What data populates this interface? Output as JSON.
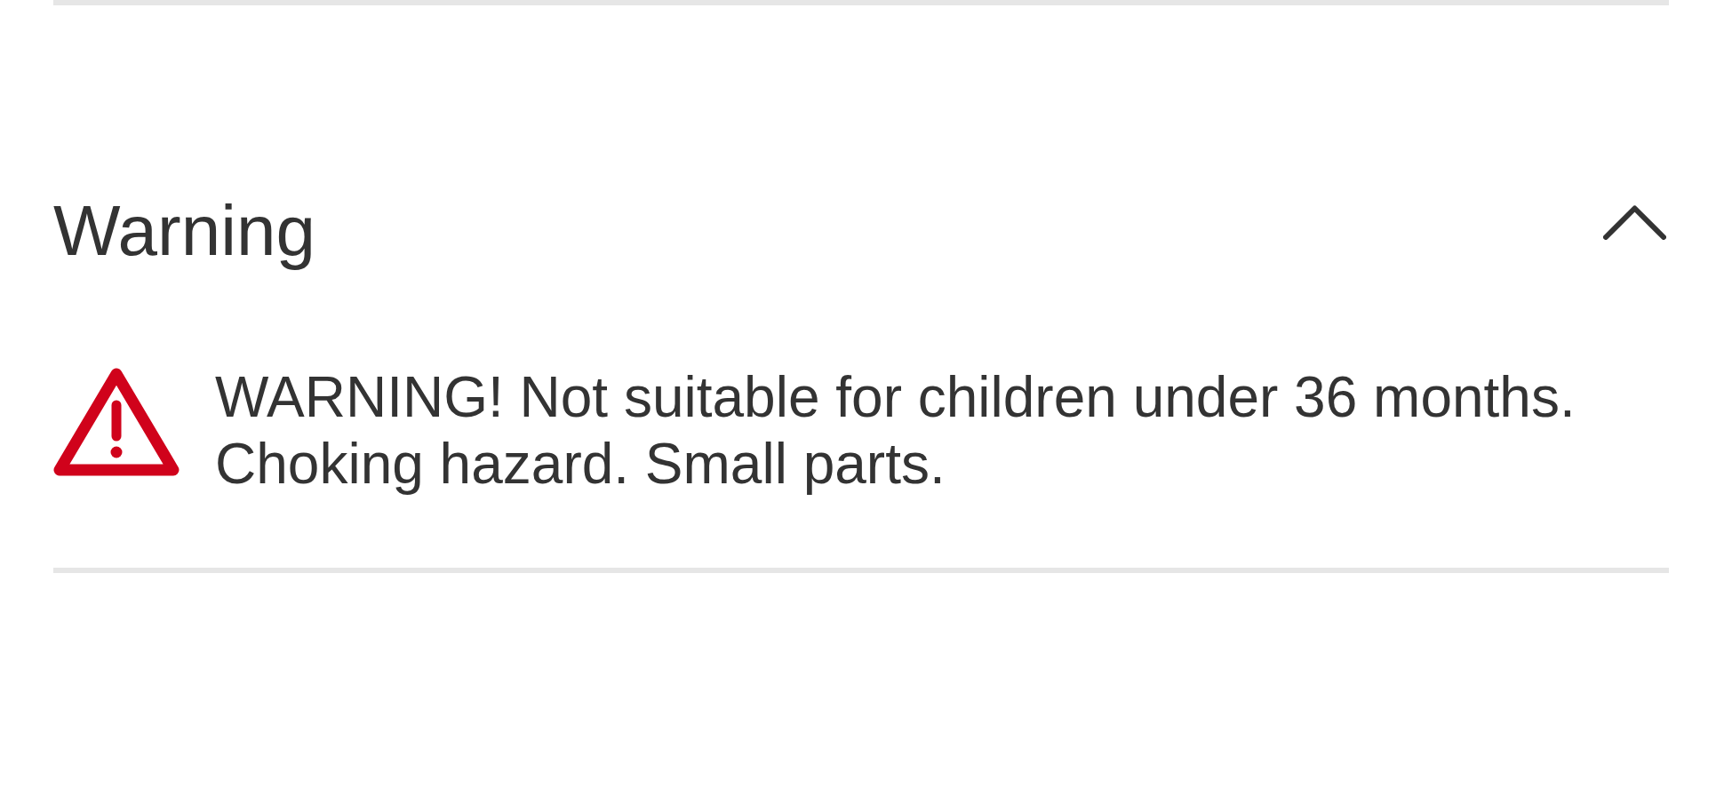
{
  "accordion": {
    "title": "Warning",
    "expanded": true,
    "content": {
      "text": "WARNING! Not suitable for children under 36 months. Choking hazard. Small parts."
    }
  }
}
